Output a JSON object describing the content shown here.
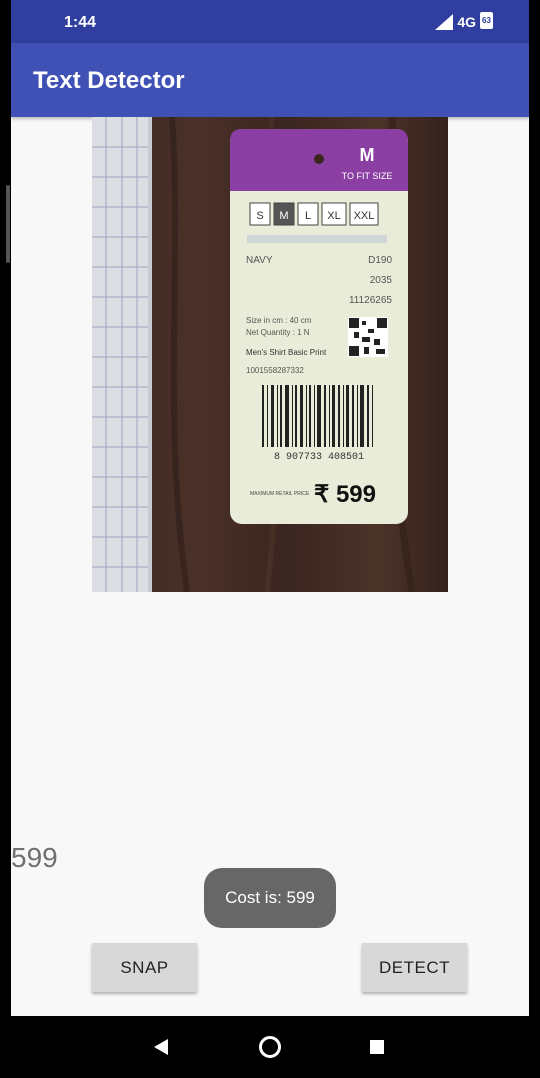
{
  "status": {
    "time": "1:44",
    "network": "4G",
    "battery": "63"
  },
  "app": {
    "title": "Text Detector"
  },
  "photo": {
    "size_label": "M",
    "size_sub": "TO FIT SIZE",
    "sizes": [
      "S",
      "M",
      "L",
      "XL",
      "XXL"
    ],
    "line1": "NAVY",
    "line1_right": "D190",
    "code1": "2035",
    "code2": "11126265",
    "size_in": "Size in cm : 40 cm",
    "quantity": "Net Quantity : 1 N",
    "product": "Men's Shirt Basic Print",
    "product_code": "1001558287332",
    "barcode": "8 907733 408501",
    "mrp_label": "MAXIMUM RETAIL PRICE",
    "price": "₹ 599"
  },
  "result": {
    "text": "599"
  },
  "toast": {
    "text": "Cost is: 599"
  },
  "buttons": {
    "snap": "SNAP",
    "detect": "DETECT"
  },
  "icons": {
    "back": "back-triangle-icon",
    "home": "home-circle-icon",
    "recents": "recents-square-icon"
  }
}
